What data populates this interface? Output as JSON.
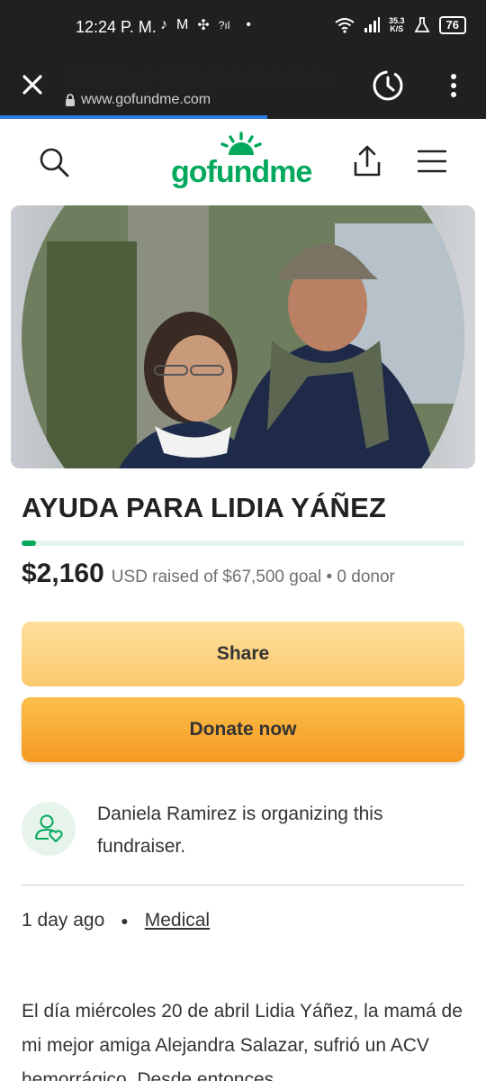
{
  "status_bar": {
    "time": "12:24 P. M.",
    "speed_value": "35.3",
    "speed_unit": "K/S",
    "battery": "76"
  },
  "browser": {
    "title": "Fundraiser by Daniela Ramirez :",
    "url": "www.gofundme.com",
    "load_progress": 0.55
  },
  "site": {
    "logo_text": "gofundme",
    "brand_color": "#02a95c"
  },
  "campaign": {
    "title": "AYUDA PARA LIDIA YÁÑEZ",
    "raised_amount": "$2,160",
    "raised_detail": "USD raised of $67,500 goal • 0 donor",
    "progress_fraction": 0.032,
    "share_label": "Share",
    "donate_label": "Donate now",
    "organizer_text": "Daniela Ramirez is organizing this fundraiser.",
    "posted": "1 day ago",
    "category": "Medical",
    "story": "El día miércoles 20 de abril Lidia Yáñez, la mamá de mi mejor amiga Alejandra Salazar, sufrió un ACV hemorrágico. Desde entonces"
  },
  "icons": {
    "close": "close-icon",
    "lock": "lock-icon",
    "history": "history-icon",
    "menu": "more-vertical-icon",
    "search": "search-icon",
    "share": "share-upload-icon",
    "hamburger": "hamburger-menu-icon",
    "organizer": "user-heart-icon"
  }
}
